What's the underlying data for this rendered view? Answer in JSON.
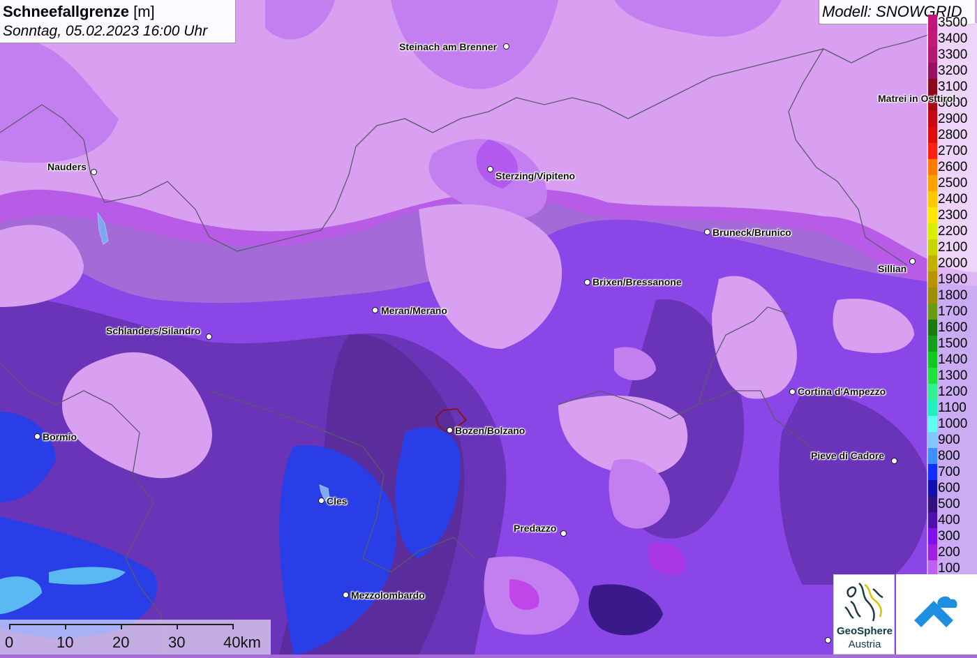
{
  "title": {
    "param": "Schneefallgrenze",
    "unit": "[m]",
    "datetime": "Sonntag, 05.02.2023 16:00 Uhr"
  },
  "model": "Modell: SNOWGRID",
  "legend": {
    "levels": [
      {
        "label": "3500",
        "color": "#c0157a"
      },
      {
        "label": "3400",
        "color": "#c21a75"
      },
      {
        "label": "3300",
        "color": "#b21870"
      },
      {
        "label": "3200",
        "color": "#981060"
      },
      {
        "label": "3100",
        "color": "#8b0a1a"
      },
      {
        "label": "3000",
        "color": "#a80a14"
      },
      {
        "label": "2900",
        "color": "#c80810"
      },
      {
        "label": "2800",
        "color": "#e00c0c"
      },
      {
        "label": "2700",
        "color": "#ff2010"
      },
      {
        "label": "2600",
        "color": "#ff7a00"
      },
      {
        "label": "2500",
        "color": "#ffa200"
      },
      {
        "label": "2400",
        "color": "#ffc800"
      },
      {
        "label": "2300",
        "color": "#ffe800"
      },
      {
        "label": "2200",
        "color": "#d8f000"
      },
      {
        "label": "2100",
        "color": "#c8d400"
      },
      {
        "label": "2000",
        "color": "#c2b000"
      },
      {
        "label": "1900",
        "color": "#b89400"
      },
      {
        "label": "1800",
        "color": "#9a9000"
      },
      {
        "label": "1700",
        "color": "#6a9a10"
      },
      {
        "label": "1600",
        "color": "#1a7a10"
      },
      {
        "label": "1500",
        "color": "#12a01c"
      },
      {
        "label": "1400",
        "color": "#10c81e"
      },
      {
        "label": "1300",
        "color": "#20e040"
      },
      {
        "label": "1200",
        "color": "#30f090"
      },
      {
        "label": "1100",
        "color": "#20f0c0"
      },
      {
        "label": "1000",
        "color": "#60fff0"
      },
      {
        "label": "900",
        "color": "#80c8ff"
      },
      {
        "label": "800",
        "color": "#3c90ff"
      },
      {
        "label": "700",
        "color": "#1030ff"
      },
      {
        "label": "600",
        "color": "#1010b0"
      },
      {
        "label": "500",
        "color": "#30107a"
      },
      {
        "label": "400",
        "color": "#5010b0"
      },
      {
        "label": "300",
        "color": "#8010f0"
      },
      {
        "label": "200",
        "color": "#a020e0"
      },
      {
        "label": "100",
        "color": "#c060f0"
      }
    ]
  },
  "cities": [
    {
      "name": "Steinach am Brenner"
    },
    {
      "name": "Nauders"
    },
    {
      "name": "Sterzing/Vipiteno"
    },
    {
      "name": "Matrei in Osttirol"
    },
    {
      "name": "Bruneck/Brunico"
    },
    {
      "name": "Sillian"
    },
    {
      "name": "Brixen/Bressanone"
    },
    {
      "name": "Meran/Merano"
    },
    {
      "name": "Schlanders/Silandro"
    },
    {
      "name": "Cortina d'Ampezzo"
    },
    {
      "name": "Bozen/Bolzano"
    },
    {
      "name": "Bormio"
    },
    {
      "name": "Pieve di Cadore"
    },
    {
      "name": "Cles"
    },
    {
      "name": "Predazzo"
    },
    {
      "name": "Mezzolombardo"
    }
  ],
  "scale": {
    "labels": [
      "0",
      "10",
      "20",
      "30",
      "40km"
    ]
  },
  "logo": {
    "line1": "GeoSphere",
    "line2": "Austria"
  },
  "colors": {
    "light": "#d9a0f2",
    "mid": "#a76ae0",
    "medium": "#8a3ff0",
    "dark": "#5a2c9c",
    "deep": "#3a1a8a",
    "blue": "#2a3ee8",
    "cyan": "#5ab8f2",
    "magenta": "#c02ee8"
  }
}
